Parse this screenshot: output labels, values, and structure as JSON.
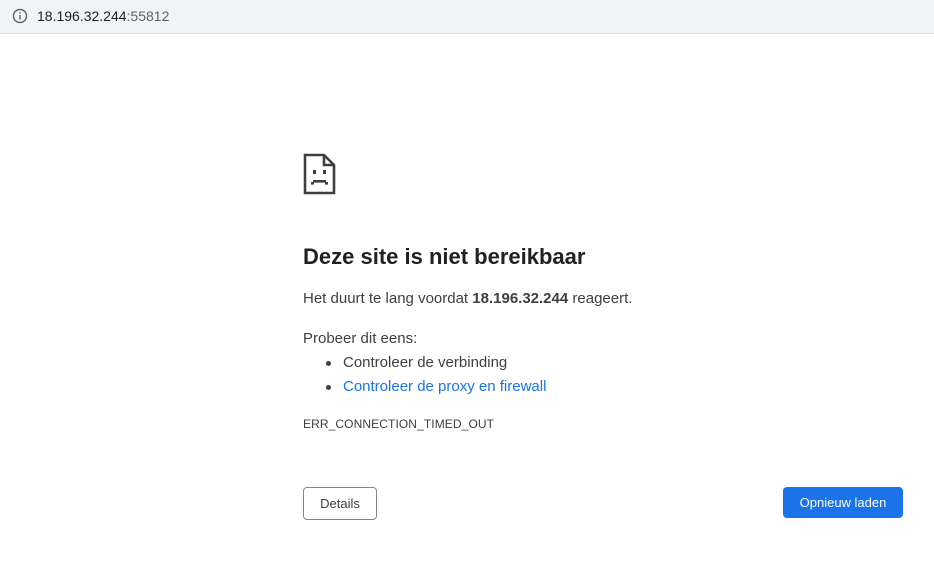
{
  "address_bar": {
    "host": "18.196.32.244",
    "port": ":55812",
    "info_icon": "info-icon"
  },
  "error_page": {
    "icon": "sad-document-icon",
    "title": "Deze site is niet bereikbaar",
    "summary_prefix": "Het duurt te lang voordat ",
    "summary_host": "18.196.32.244",
    "summary_suffix": " reageert.",
    "suggestions_heading": "Probeer dit eens:",
    "suggestions": [
      {
        "label": "Controleer de verbinding",
        "is_link": false
      },
      {
        "label": "Controleer de proxy en firewall",
        "is_link": true
      }
    ],
    "error_code": "ERR_CONNECTION_TIMED_OUT",
    "details_button": "Details",
    "reload_button": "Opnieuw laden"
  },
  "colors": {
    "link": "#1a73e8",
    "primary_button": "#1a73e8",
    "text": "#202124",
    "address_bar_bg": "#f1f3f4"
  }
}
